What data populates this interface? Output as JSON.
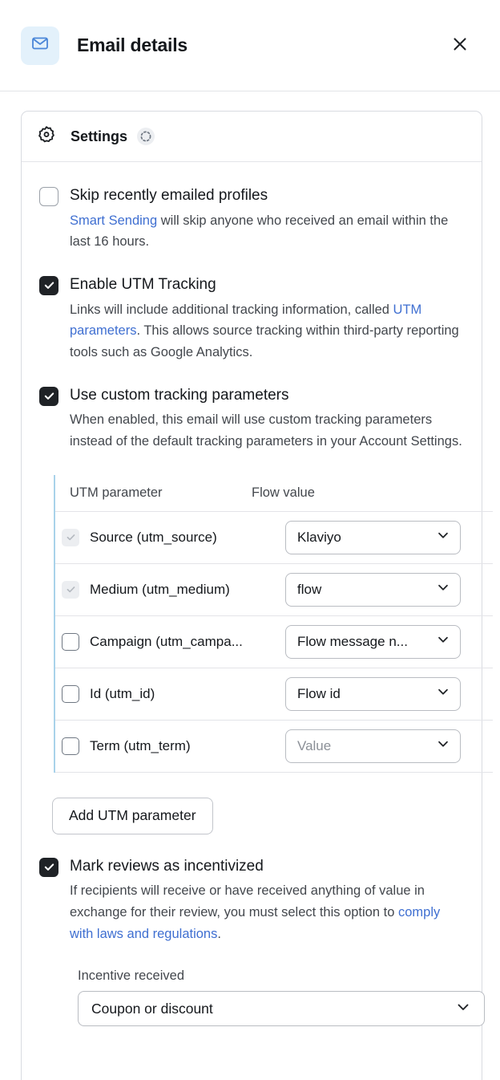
{
  "header": {
    "title": "Email details",
    "email_icon": "envelope-icon",
    "close_icon": "close-icon"
  },
  "card": {
    "title": "Settings",
    "gear_icon": "gear-icon",
    "spinner_icon": "loading-spinner-icon"
  },
  "options": {
    "skip_recently_emailed": {
      "label": "Skip recently emailed profiles",
      "checked": false,
      "help_link": "Smart Sending",
      "help_rest": " will skip anyone who received an email within the last 16 hours."
    },
    "enable_utm": {
      "label": "Enable UTM Tracking",
      "checked": true,
      "help_pre": "Links will include additional tracking information, called ",
      "help_link": "UTM parameters",
      "help_rest": ". This allows source tracking within third-party reporting tools such as Google Analytics."
    },
    "custom_tracking": {
      "label": "Use custom tracking parameters",
      "checked": true,
      "help": "When enabled, this email will use custom tracking parameters instead of the default tracking parameters in your Account Settings."
    },
    "mark_incentivized": {
      "label": "Mark reviews as incentivized",
      "checked": true,
      "help_pre": "If recipients will receive or have received anything of value in exchange for their review, you must select this option to ",
      "help_link": "comply with laws and regulations",
      "help_rest": "."
    }
  },
  "utm_table": {
    "columns": [
      "UTM parameter",
      "Flow value"
    ],
    "rows": [
      {
        "param": "Source (utm_source)",
        "value": "Klaviyo",
        "checked": true,
        "disabled": true,
        "is_placeholder": false
      },
      {
        "param": "Medium (utm_medium)",
        "value": "flow",
        "checked": true,
        "disabled": true,
        "is_placeholder": false
      },
      {
        "param": "Campaign (utm_campa...",
        "value": "Flow message n...",
        "checked": false,
        "disabled": false,
        "is_placeholder": false
      },
      {
        "param": "Id (utm_id)",
        "value": "Flow id",
        "checked": false,
        "disabled": false,
        "is_placeholder": false
      },
      {
        "param": "Term (utm_term)",
        "value": "Value",
        "checked": false,
        "disabled": false,
        "is_placeholder": true
      }
    ]
  },
  "add_utm_button": "Add UTM parameter",
  "incentive": {
    "label": "Incentive received",
    "value": "Coupon or discount"
  },
  "colors": {
    "accent_blue": "#3f6fd1",
    "icon_blue": "#4a86d8",
    "badge_bg": "#e3f1fb",
    "checkbox_on": "#1f2226",
    "table_rule": "#a9d2ea"
  }
}
